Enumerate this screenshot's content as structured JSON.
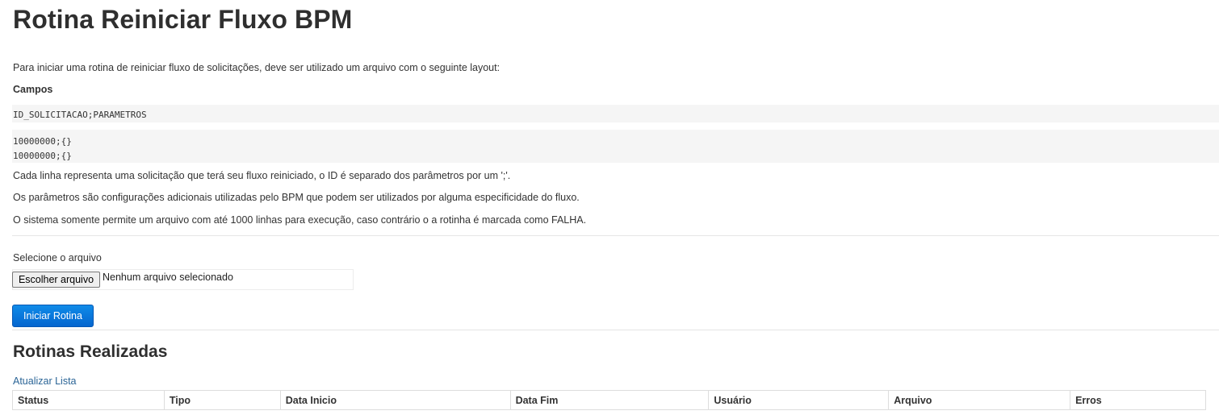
{
  "page": {
    "title": "Rotina Reiniciar Fluxo BPM",
    "intro": "Para iniciar uma rotina de reiniciar fluxo de solicitações, deve ser utilizado um arquivo com o seguinte layout:",
    "fields_heading": "Campos",
    "layout_header": "ID_SOLICITACAO;PARAMETROS",
    "layout_lines": [
      "10000000;{}",
      "10000000;{}"
    ],
    "paragraphs": [
      "Cada linha representa uma solicitação que terá seu fluxo reiniciado, o ID é separado dos parâmetros por um ';'.",
      "Os parâmetros são configurações adicionais utilizadas pelo BPM que podem ser utilizados por alguma especificidade do fluxo.",
      "O sistema somente permite um arquivo com até 1000 linhas para execução, caso contrário o a rotinha é marcada como FALHA."
    ]
  },
  "form": {
    "file_label": "Selecione o arquivo",
    "file_button": "Escolher arquivo",
    "file_status": "Nenhum arquivo selecionado",
    "submit_label": "Iniciar Rotina"
  },
  "history": {
    "title": "Rotinas Realizadas",
    "refresh_label": "Atualizar Lista",
    "columns": [
      "Status",
      "Tipo",
      "Data Inicio",
      "Data Fim",
      "Usuário",
      "Arquivo",
      "Erros"
    ]
  },
  "colors": {
    "primary": "#0a78dc",
    "link": "#2a6496",
    "code_bg": "#f5f5f5"
  }
}
